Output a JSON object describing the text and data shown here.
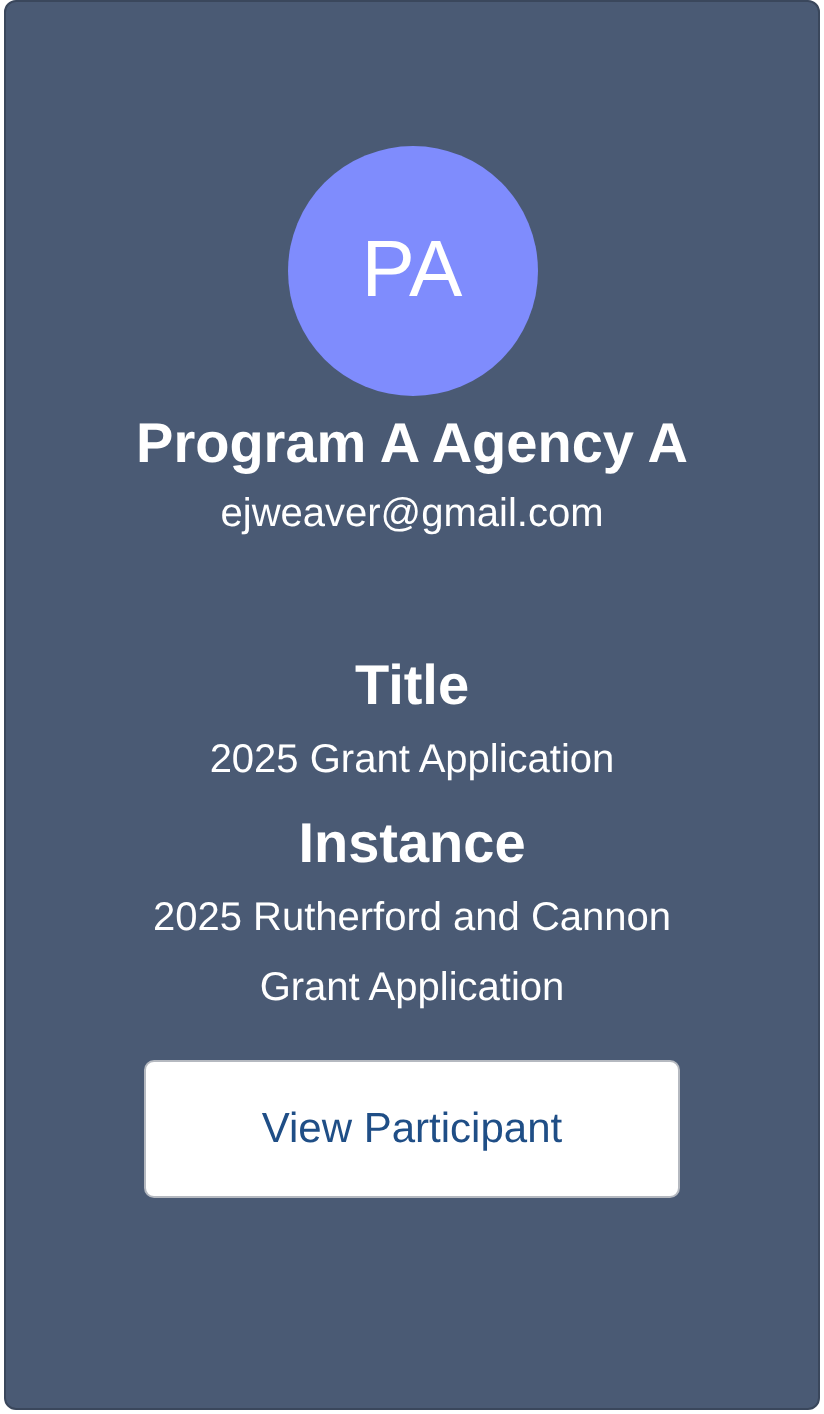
{
  "profile": {
    "initials": "PA",
    "name": "Program A Agency A",
    "email": "ejweaver@gmail.com"
  },
  "fields": [
    {
      "label": "Title",
      "value": "2025 Grant Application"
    },
    {
      "label": "Instance",
      "value": "2025 Rutherford and Cannon Grant Application"
    }
  ],
  "button": "View Participant"
}
